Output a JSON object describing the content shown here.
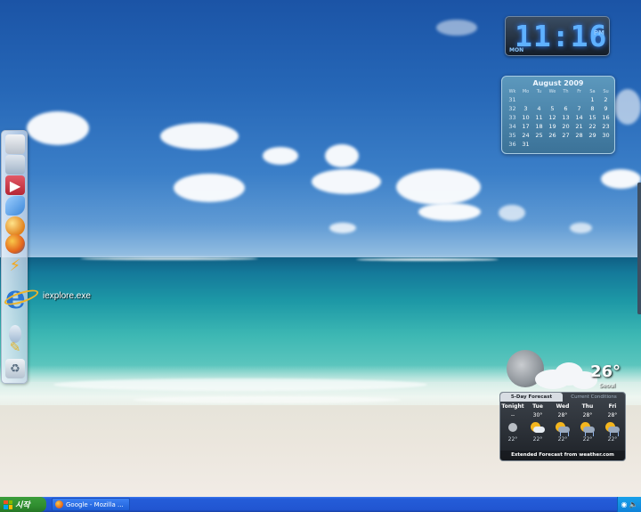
{
  "clock": {
    "time": "11:16",
    "ampm": "PM",
    "weekday": "MON"
  },
  "calendar": {
    "title": "August 2009",
    "headers": [
      "Wk",
      "Mo",
      "Tu",
      "We",
      "Th",
      "Fr",
      "Sa",
      "Su"
    ],
    "rows": [
      [
        "31",
        "",
        "",
        "",
        "",
        "",
        "1",
        "2"
      ],
      [
        "32",
        "3",
        "4",
        "5",
        "6",
        "7",
        "8",
        "9"
      ],
      [
        "33",
        "10",
        "11",
        "12",
        "13",
        "14",
        "15",
        "16"
      ],
      [
        "34",
        "17",
        "18",
        "19",
        "20",
        "21",
        "22",
        "23"
      ],
      [
        "35",
        "24",
        "25",
        "26",
        "27",
        "28",
        "29",
        "30"
      ],
      [
        "36",
        "31",
        "",
        "",
        "",
        "",
        "",
        ""
      ]
    ]
  },
  "desktop_icon": {
    "label": "iexplore.exe",
    "icon": "internet-explorer-icon"
  },
  "dock": {
    "items": [
      {
        "icon": "drive-icon",
        "color": "#d9dde3"
      },
      {
        "icon": "network-icon",
        "color": "#c7d3e0"
      },
      {
        "icon": "media-icon",
        "color": "#d43d4b"
      },
      {
        "icon": "messenger-icon",
        "color": "#5a9fe0"
      },
      {
        "icon": "ball-icon",
        "color": "#f0a12d"
      },
      {
        "icon": "firefox-icon",
        "color": "#e3631a"
      },
      {
        "icon": "winamp-icon",
        "color": "#222222"
      },
      {
        "icon": "unknown-app-icon",
        "color": "#8ab0d8"
      },
      {
        "icon": "pencil-icon",
        "color": "#f3c84a"
      },
      {
        "icon": "recycle-bin-icon",
        "color": "#c9d4df"
      }
    ]
  },
  "weather": {
    "current_temp": "26°",
    "city": "Seoul",
    "tabs": [
      {
        "label": "5-Day Forecast",
        "active": true
      },
      {
        "label": "Current Conditions",
        "active": false
      }
    ],
    "days": [
      {
        "name": "Tonight",
        "high": "--",
        "low": "22°",
        "icon": "moon-icon"
      },
      {
        "name": "Tue",
        "high": "30°",
        "low": "22°",
        "icon": "partly-cloudy-icon"
      },
      {
        "name": "Wed",
        "high": "28°",
        "low": "22°",
        "icon": "thunderstorm-icon"
      },
      {
        "name": "Thu",
        "high": "28°",
        "low": "22°",
        "icon": "thunderstorm-icon"
      },
      {
        "name": "Fri",
        "high": "28°",
        "low": "22°",
        "icon": "thunderstorm-icon"
      }
    ],
    "footer": "Extended Forecast from weather.com"
  },
  "taskbar": {
    "start_label": "시작",
    "tasks": [
      {
        "label": "Google - Mozilla ...",
        "icon": "firefox-icon"
      }
    ],
    "tray_icons": [
      "network-icon",
      "volume-icon"
    ]
  },
  "colors": {
    "taskbar": "#245dd9",
    "start": "#2f8e2f",
    "clock_digits": "#5fb1ff"
  }
}
